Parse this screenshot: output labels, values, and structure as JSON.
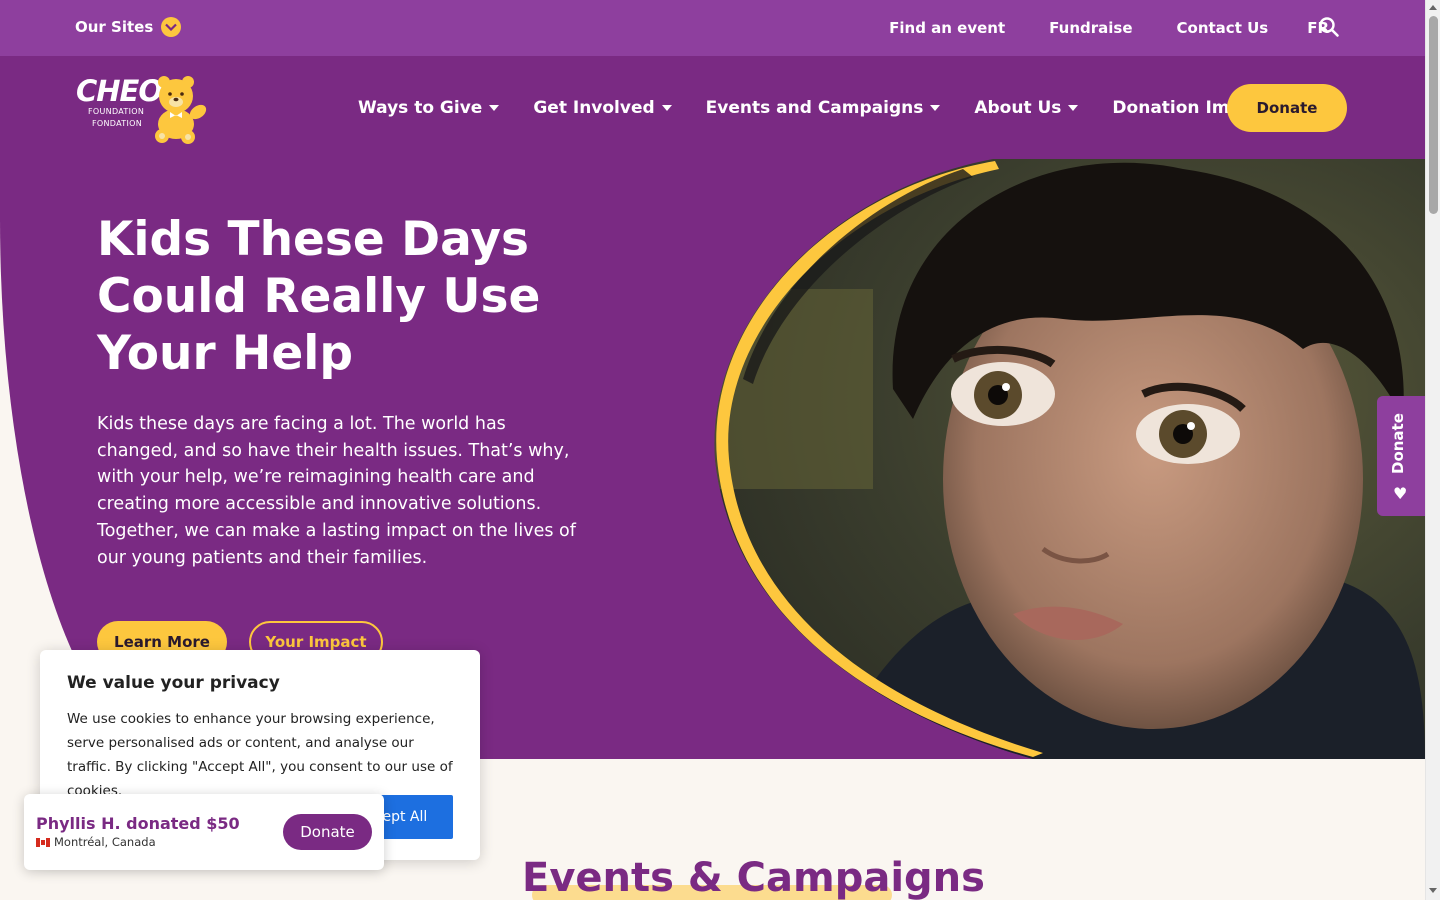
{
  "topbar": {
    "our_sites": "Our Sites",
    "links": [
      "Find an event",
      "Fundraise",
      "Contact Us",
      "FR"
    ]
  },
  "logo": {
    "line1": "CHEO",
    "line2": "FOUNDATION",
    "line3": "FONDATION"
  },
  "nav": {
    "items": [
      "Ways to Give",
      "Get Involved",
      "Events and Campaigns",
      "About Us",
      "Donation Impact"
    ],
    "donate": "Donate"
  },
  "hero": {
    "title": "Kids These Days Could Really Use Your Help",
    "body": "Kids these days are facing a lot. The world has changed, and so have their health issues. That’s why, with your help, we’re reimagining health care and creating more accessible and innovative solutions. Together, we can make a lasting impact on the lives of our young patients and their families.",
    "learn_more": "Learn More",
    "your_impact": "Your Impact"
  },
  "side_tab": {
    "label": "Donate"
  },
  "section": {
    "title": "Events & Campaigns"
  },
  "cookie": {
    "title": "We value your privacy",
    "body": "We use cookies to enhance your browsing experience, serve personalised ads or content, and analyse our traffic. By clicking \"Accept All\", you consent to our use of cookies.",
    "accept": "Accept All"
  },
  "toast": {
    "message": "Phyllis H. donated $50",
    "location": "Montréal, Canada",
    "donate": "Donate"
  },
  "colors": {
    "purple_dark": "#7a2a83",
    "purple_light": "#8e3f9e",
    "yellow": "#fdc73e",
    "blue": "#1d6fe0"
  }
}
